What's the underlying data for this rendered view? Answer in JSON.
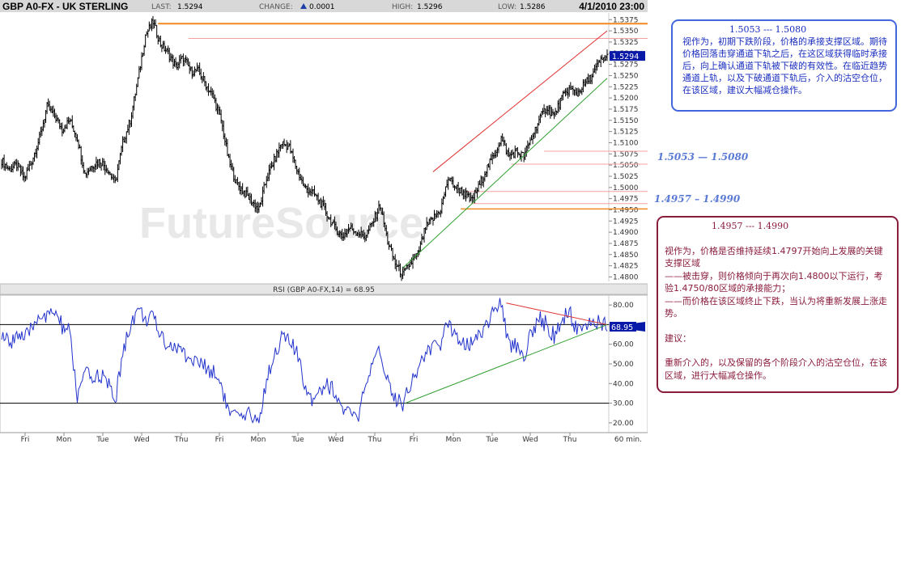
{
  "header": {
    "symbol": "GBP A0-FX - UK STERLING",
    "last_label": "LAST:",
    "last_value": "1.5294",
    "change_label": "CHANGE:",
    "change_value": "0.0001",
    "high_label": "HIGH:",
    "high_value": "1.5296",
    "low_label": "LOW:",
    "low_value": "1.5286",
    "datetime": "4/1/2010 23:00"
  },
  "watermark": "FutureSource",
  "rsi_title": "RSI (GBP A0-FX,14) = 68.95",
  "x_axis": {
    "labels": [
      "Fri",
      "Mon",
      "Tue",
      "Wed",
      "Thu",
      "Fri",
      "Mon",
      "Tue",
      "Wed",
      "Thu",
      "Fri",
      "Mon",
      "Tue",
      "Wed",
      "Thu"
    ],
    "interval": "60 min."
  },
  "levels": {
    "upper_label": "1.5053 — 1.5080",
    "lower_label": "1.4957 – 1.4990"
  },
  "note_blue": {
    "head": "1.5053  --- 1.5080",
    "body": "视作为，初期下跌阶段，价格的承接支撑区域。期待价格回落击穿通道下轨之后，在这区域获得临时承接后，向上确认通道下轨被下破的有效性。在临近趋势通道上轨，以及下破通道下轨后，介入的沽空仓位，在该区域，建议大幅减仓操作。"
  },
  "note_red": {
    "head": "1.4957  ---  1.4990",
    "p1": "视作为，价格是否维持延续1.4797开始向上发展的关键支撑区域",
    "p2": "——被击穿，则价格倾向于再次向1.4800以下运行，考验1.4750/80区域的承接能力；",
    "p3": "——而价格在该区域终止下跌，当认为将重新发展上涨走势。",
    "p4": "建议：",
    "p5": "重新介入的，以及保留的各个阶段介入的沽空仓位，在该区域，进行大幅减仓操作。"
  },
  "chart_data": [
    {
      "type": "bar",
      "title": "GBP A0-FX - UK STERLING",
      "interval": "60 min.",
      "ylim": [
        1.479,
        1.539
      ],
      "y_ticks": [
        1.48,
        1.4825,
        1.485,
        1.4875,
        1.49,
        1.4925,
        1.495,
        1.4975,
        1.5,
        1.5025,
        1.505,
        1.5075,
        1.51,
        1.5125,
        1.515,
        1.5175,
        1.52,
        1.5225,
        1.525,
        1.5275,
        1.53,
        1.5325,
        1.535,
        1.5375
      ],
      "y_tick_labels": [
        "1.4800",
        "1.4825",
        "1.4850",
        "1.4875",
        "1.4900",
        "1.4925",
        "1.4950",
        "1.4975",
        "1.5000",
        "1.5025",
        "1.5050",
        "1.5075",
        "1.5100",
        "1.5125",
        "1.5150",
        "1.5175",
        "1.5200",
        "1.5225",
        "1.5250",
        "1.5275",
        "1.5300",
        "1.5325",
        "1.5350",
        "1.5375"
      ],
      "last_value": 1.5294,
      "close_path": [
        [
          0,
          1.506
        ],
        [
          3,
          1.504
        ],
        [
          6,
          1.505
        ],
        [
          9,
          1.502
        ],
        [
          12,
          1.506
        ],
        [
          15,
          1.511
        ],
        [
          18,
          1.518
        ],
        [
          21,
          1.516
        ],
        [
          24,
          1.513
        ],
        [
          27,
          1.515
        ],
        [
          30,
          1.511
        ],
        [
          33,
          1.503
        ],
        [
          36,
          1.505
        ],
        [
          39,
          1.506
        ],
        [
          42,
          1.504
        ],
        [
          45,
          1.501
        ],
        [
          48,
          1.51
        ],
        [
          51,
          1.515
        ],
        [
          54,
          1.524
        ],
        [
          57,
          1.534
        ],
        [
          60,
          1.537
        ],
        [
          63,
          1.532
        ],
        [
          66,
          1.53
        ],
        [
          69,
          1.527
        ],
        [
          72,
          1.529
        ],
        [
          75,
          1.526
        ],
        [
          78,
          1.526
        ],
        [
          81,
          1.523
        ],
        [
          84,
          1.52
        ],
        [
          87,
          1.515
        ],
        [
          90,
          1.506
        ],
        [
          93,
          1.501
        ],
        [
          96,
          1.499
        ],
        [
          99,
          1.497
        ],
        [
          102,
          1.495
        ],
        [
          105,
          1.502
        ],
        [
          108,
          1.506
        ],
        [
          111,
          1.51
        ],
        [
          114,
          1.509
        ],
        [
          117,
          1.504
        ],
        [
          120,
          1.5
        ],
        [
          123,
          1.499
        ],
        [
          126,
          1.497
        ],
        [
          129,
          1.494
        ],
        [
          132,
          1.491
        ],
        [
          135,
          1.489
        ],
        [
          138,
          1.491
        ],
        [
          141,
          1.49
        ],
        [
          144,
          1.489
        ],
        [
          147,
          1.492
        ],
        [
          150,
          1.496
        ],
        [
          153,
          1.488
        ],
        [
          156,
          1.483
        ],
        [
          159,
          1.4805
        ],
        [
          162,
          1.483
        ],
        [
          165,
          1.485
        ],
        [
          168,
          1.491
        ],
        [
          171,
          1.493
        ],
        [
          174,
          1.495
        ],
        [
          177,
          1.502
        ],
        [
          180,
          1.5
        ],
        [
          183,
          1.499
        ],
        [
          186,
          1.497
        ],
        [
          189,
          1.5
        ],
        [
          192,
          1.504
        ],
        [
          195,
          1.507
        ],
        [
          198,
          1.511
        ],
        [
          201,
          1.507
        ],
        [
          204,
          1.508
        ],
        [
          207,
          1.507
        ],
        [
          210,
          1.511
        ],
        [
          213,
          1.515
        ],
        [
          216,
          1.518
        ],
        [
          219,
          1.516
        ],
        [
          222,
          1.52
        ],
        [
          225,
          1.522
        ],
        [
          228,
          1.521
        ],
        [
          231,
          1.523
        ],
        [
          234,
          1.525
        ],
        [
          237,
          1.528
        ],
        [
          240,
          1.5294
        ]
      ],
      "annotations": {
        "orange_lines": [
          1.5366,
          1.4952
        ],
        "pink_horizontal_lines": [
          1.5333,
          1.5081,
          1.5052,
          1.4991,
          1.4964
        ],
        "channel_upper": [
          [
            171,
            1.5035
          ],
          [
            240,
            1.535
          ]
        ],
        "channel_lower": [
          [
            159,
            1.482
          ],
          [
            240,
            1.5244
          ]
        ]
      }
    },
    {
      "type": "line",
      "title": "RSI (GBP A0-FX,14) = 68.95",
      "ylim": [
        15,
        85
      ],
      "y_ticks": [
        20,
        30,
        40,
        50,
        60,
        70,
        80
      ],
      "y_tick_labels": [
        "20.00",
        "30.00",
        "40.00",
        "50.00",
        "60.00",
        "70.00",
        "80.00"
      ],
      "h_lines": [
        30,
        70
      ],
      "last_value": 68.95,
      "path": [
        [
          0,
          65
        ],
        [
          3,
          60
        ],
        [
          6,
          66
        ],
        [
          9,
          62
        ],
        [
          12,
          68
        ],
        [
          15,
          76
        ],
        [
          18,
          73
        ],
        [
          21,
          77
        ],
        [
          24,
          69
        ],
        [
          27,
          66
        ],
        [
          30,
          33
        ],
        [
          33,
          45
        ],
        [
          36,
          42
        ],
        [
          39,
          45
        ],
        [
          42,
          40
        ],
        [
          45,
          31
        ],
        [
          48,
          55
        ],
        [
          51,
          70
        ],
        [
          54,
          78
        ],
        [
          57,
          73
        ],
        [
          60,
          73
        ],
        [
          63,
          65
        ],
        [
          66,
          60
        ],
        [
          69,
          58
        ],
        [
          72,
          56
        ],
        [
          75,
          52
        ],
        [
          78,
          51
        ],
        [
          81,
          48
        ],
        [
          84,
          46
        ],
        [
          87,
          40
        ],
        [
          90,
          25
        ],
        [
          93,
          23
        ],
        [
          96,
          21
        ],
        [
          99,
          25
        ],
        [
          102,
          20
        ],
        [
          105,
          42
        ],
        [
          108,
          55
        ],
        [
          111,
          63
        ],
        [
          114,
          62
        ],
        [
          117,
          55
        ],
        [
          120,
          40
        ],
        [
          123,
          33
        ],
        [
          126,
          37
        ],
        [
          129,
          40
        ],
        [
          132,
          36
        ],
        [
          135,
          27
        ],
        [
          138,
          24
        ],
        [
          141,
          22
        ],
        [
          144,
          37
        ],
        [
          147,
          48
        ],
        [
          150,
          57
        ],
        [
          153,
          42
        ],
        [
          156,
          33
        ],
        [
          159,
          30
        ],
        [
          162,
          40
        ],
        [
          165,
          48
        ],
        [
          168,
          55
        ],
        [
          171,
          58
        ],
        [
          174,
          60
        ],
        [
          177,
          71
        ],
        [
          180,
          65
        ],
        [
          183,
          62
        ],
        [
          186,
          60
        ],
        [
          189,
          65
        ],
        [
          192,
          70
        ],
        [
          195,
          77
        ],
        [
          198,
          80
        ],
        [
          201,
          60
        ],
        [
          204,
          60
        ],
        [
          207,
          55
        ],
        [
          210,
          65
        ],
        [
          213,
          73
        ],
        [
          216,
          70
        ],
        [
          219,
          64
        ],
        [
          222,
          72
        ],
        [
          225,
          76
        ],
        [
          228,
          67
        ],
        [
          231,
          72
        ],
        [
          234,
          68
        ],
        [
          237,
          71
        ],
        [
          240,
          68.95
        ]
      ],
      "annotations": {
        "trend_down": [
          [
            200,
            81
          ],
          [
            240,
            70
          ]
        ],
        "trend_up": [
          [
            160,
            30
          ],
          [
            240,
            70
          ]
        ]
      }
    }
  ],
  "colors": {
    "price": "#000000",
    "rsi": "#2233cc",
    "orange": "#f08a20",
    "pink": "#f4a0a0",
    "channel_upper": "#e03030",
    "channel_lower": "#30a030",
    "header_bg": "#d8d8d8",
    "note_blue": "#4466dd",
    "note_red": "#8a1c3c",
    "level_label": "#5a7ad6"
  }
}
